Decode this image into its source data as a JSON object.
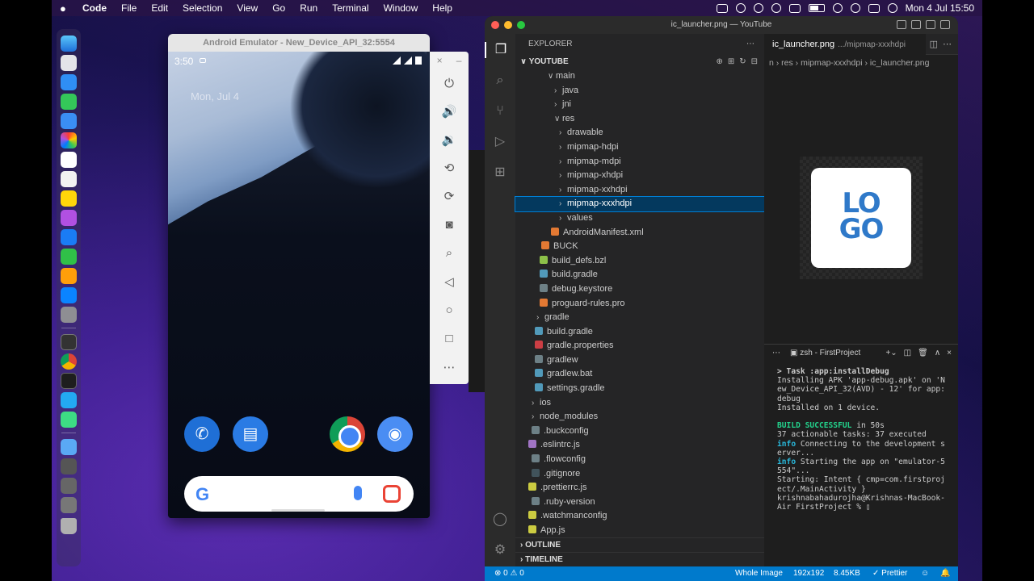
{
  "menubar": {
    "app": "Code",
    "items": [
      "File",
      "Edit",
      "Selection",
      "View",
      "Go",
      "Run",
      "Terminal",
      "Window",
      "Help"
    ],
    "clock": "Mon 4 Jul  15:50"
  },
  "emulator": {
    "title": "Android Emulator - New_Device_API_32:5554",
    "time": "3:50",
    "date": "Mon, Jul 4",
    "google_letter": "G"
  },
  "vscode": {
    "window_title": "ic_launcher.png — YouTube",
    "explorer_label": "EXPLORER",
    "workspace": "YOUTUBE",
    "tree": [
      {
        "name": "main",
        "indent": 40,
        "chev": "∨",
        "icon": "",
        "sel": false
      },
      {
        "name": "java",
        "indent": 48,
        "chev": "›",
        "icon": "",
        "sel": false
      },
      {
        "name": "jni",
        "indent": 48,
        "chev": "›",
        "icon": "",
        "sel": false
      },
      {
        "name": "res",
        "indent": 48,
        "chev": "∨",
        "icon": "",
        "sel": false
      },
      {
        "name": "drawable",
        "indent": 54,
        "chev": "›",
        "icon": "",
        "sel": false
      },
      {
        "name": "mipmap-hdpi",
        "indent": 54,
        "chev": "›",
        "icon": "",
        "sel": false
      },
      {
        "name": "mipmap-mdpi",
        "indent": 54,
        "chev": "›",
        "icon": "",
        "sel": false
      },
      {
        "name": "mipmap-xhdpi",
        "indent": 54,
        "chev": "›",
        "icon": "",
        "sel": false
      },
      {
        "name": "mipmap-xxhdpi",
        "indent": 54,
        "chev": "›",
        "icon": "",
        "sel": false
      },
      {
        "name": "mipmap-xxxhdpi",
        "indent": 54,
        "chev": "›",
        "icon": "",
        "sel": true
      },
      {
        "name": "values",
        "indent": 54,
        "chev": "›",
        "icon": "",
        "sel": false
      },
      {
        "name": "AndroidManifest.xml",
        "indent": 44,
        "chev": "",
        "icon": "#e37933",
        "sel": false
      },
      {
        "name": "BUCK",
        "indent": 32,
        "chev": "",
        "icon": "#e37933",
        "sel": false
      },
      {
        "name": "build_defs.bzl",
        "indent": 30,
        "chev": "",
        "icon": "#8dc149",
        "sel": false
      },
      {
        "name": "build.gradle",
        "indent": 30,
        "chev": "",
        "icon": "#519aba",
        "sel": false
      },
      {
        "name": "debug.keystore",
        "indent": 30,
        "chev": "",
        "icon": "#6d8086",
        "sel": false
      },
      {
        "name": "proguard-rules.pro",
        "indent": 30,
        "chev": "",
        "icon": "#e37933",
        "sel": false
      },
      {
        "name": "gradle",
        "indent": 26,
        "chev": "›",
        "icon": "",
        "sel": false
      },
      {
        "name": "build.gradle",
        "indent": 24,
        "chev": "",
        "icon": "#519aba",
        "sel": false
      },
      {
        "name": "gradle.properties",
        "indent": 24,
        "chev": "",
        "icon": "#cc3e44",
        "sel": false
      },
      {
        "name": "gradlew",
        "indent": 24,
        "chev": "",
        "icon": "#6d8086",
        "sel": false
      },
      {
        "name": "gradlew.bat",
        "indent": 24,
        "chev": "",
        "icon": "#519aba",
        "sel": false
      },
      {
        "name": "settings.gradle",
        "indent": 24,
        "chev": "",
        "icon": "#519aba",
        "sel": false
      },
      {
        "name": "ios",
        "indent": 20,
        "chev": "›",
        "icon": "",
        "sel": false
      },
      {
        "name": "node_modules",
        "indent": 20,
        "chev": "›",
        "icon": "",
        "sel": false
      },
      {
        "name": ".buckconfig",
        "indent": 20,
        "chev": "",
        "icon": "#6d8086",
        "sel": false
      },
      {
        "name": ".eslintrc.js",
        "indent": 16,
        "chev": "",
        "icon": "#a074c4",
        "sel": false
      },
      {
        "name": ".flowconfig",
        "indent": 20,
        "chev": "",
        "icon": "#6d8086",
        "sel": false
      },
      {
        "name": ".gitignore",
        "indent": 20,
        "chev": "",
        "icon": "#41535b",
        "sel": false
      },
      {
        "name": ".prettierrc.js",
        "indent": 16,
        "chev": "",
        "icon": "#cbcb41",
        "sel": false
      },
      {
        "name": ".ruby-version",
        "indent": 20,
        "chev": "",
        "icon": "#6d8086",
        "sel": false
      },
      {
        "name": ".watchmanconfig",
        "indent": 16,
        "chev": "",
        "icon": "#cbcb41",
        "sel": false
      },
      {
        "name": "App.js",
        "indent": 16,
        "chev": "",
        "icon": "#cbcb41",
        "sel": false
      }
    ],
    "outline": "OUTLINE",
    "timeline": "TIMELINE",
    "tab_name": "ic_launcher.png",
    "tab_path": ".../mipmap-xxxhdpi",
    "breadcrumb": "n › res › mipmap-xxxhdpi › ic_launcher.png",
    "logo_text_1": "LO",
    "logo_text_2": "GO",
    "terminal_name": "zsh - FirstProject",
    "terminal": {
      "l1": "> Task :app:installDebug",
      "l2": "Installing APK 'app-debug.apk' on 'New_Device_API_32(AVD) - 12' for app:debug",
      "l3": "Installed on 1 device.",
      "l4a": "BUILD SUCCESSFUL",
      "l4b": " in 50s",
      "l5": "37 actionable tasks: 37 executed",
      "l6a": "info",
      "l6b": " Connecting to the development server...",
      "l7a": "info",
      "l7b": " Starting the app on \"emulator-5554\"...",
      "l8": "Starting: Intent { cmp=com.firstproject/.MainActivity }",
      "l9": "krishnabahadurojha@Krishnas-MacBook-Air FirstProject % ▯"
    },
    "status": {
      "errors": "⊗ 0 ⚠ 0",
      "image_mode": "Whole Image",
      "dims": "192x192",
      "size": "8.45KB",
      "prettier": "✓ Prettier"
    }
  }
}
